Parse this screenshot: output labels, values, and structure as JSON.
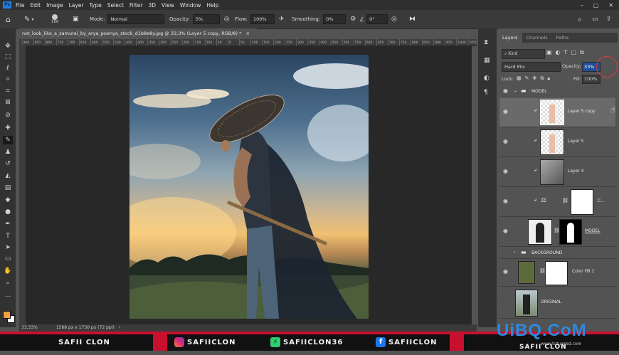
{
  "menu": [
    "File",
    "Edit",
    "Image",
    "Layer",
    "Type",
    "Select",
    "Filter",
    "3D",
    "View",
    "Window",
    "Help"
  ],
  "app_logo": "Ps",
  "options": {
    "brush_size": "100",
    "mode_label": "Mode:",
    "mode_value": "Normal",
    "opacity_label": "Opacity:",
    "opacity_value": "5%",
    "flow_label": "Flow:",
    "flow_value": "100%",
    "smoothing_label": "Smoothing:",
    "smoothing_value": "0%",
    "angle_value": "0°"
  },
  "document": {
    "tab_title": "not_look_like_a_samurai_by_arya_poenya_stock_d1b8e8y.jpg @ 33,3% (Layer 5 copy, RGB/8) *",
    "zoom": "33,33%",
    "doc_size": "1568 px x 1730 px (72 ppi)",
    "ruler_ticks": [
      "900",
      "850",
      "800",
      "750",
      "700",
      "650",
      "600",
      "550",
      "500",
      "450",
      "400",
      "350",
      "300",
      "250",
      "200",
      "150",
      "100",
      "50",
      "0",
      "50",
      "100",
      "150",
      "200",
      "250",
      "300",
      "350",
      "400",
      "450",
      "500",
      "550",
      "600",
      "650",
      "700",
      "750",
      "800",
      "850",
      "900",
      "950",
      "1000",
      "1050"
    ]
  },
  "layers_panel": {
    "tabs": [
      "Layers",
      "Channels",
      "Paths"
    ],
    "kind_label": "Kind",
    "blend_mode": "Hard Mix",
    "opacity_label": "Opacity:",
    "opacity_value": "33%",
    "lock_label": "Lock:",
    "fill_label": "Fill:",
    "fill_value": "100%",
    "layers": [
      {
        "name": "MODEL",
        "type": "group"
      },
      {
        "name": "Layer 5 copy",
        "type": "layer"
      },
      {
        "name": "Layer 5",
        "type": "layer"
      },
      {
        "name": "Layer 4",
        "type": "layer"
      },
      {
        "name": "C...",
        "type": "adjustment"
      },
      {
        "name": "MODEL",
        "type": "masked"
      },
      {
        "name": "BACKGROUND",
        "type": "group"
      },
      {
        "name": "Color Fill 1",
        "type": "fill"
      },
      {
        "name": "ORIGINAL",
        "type": "layer"
      }
    ]
  },
  "banner": {
    "left_name": "SAFII CLON",
    "instagram": "SAFIICLON",
    "other": "SAFIICLON36",
    "facebook": "SAFIICLON",
    "right_name": "SAFII CLON",
    "watermark": "UiBQ.CoM",
    "watermark_sub": "www.tutuapsd.com"
  },
  "colors": {
    "accent_red": "#c8102e",
    "ps_blue": "#1f7ee0",
    "foreground": "#f0a040",
    "background": "#ffffff"
  }
}
